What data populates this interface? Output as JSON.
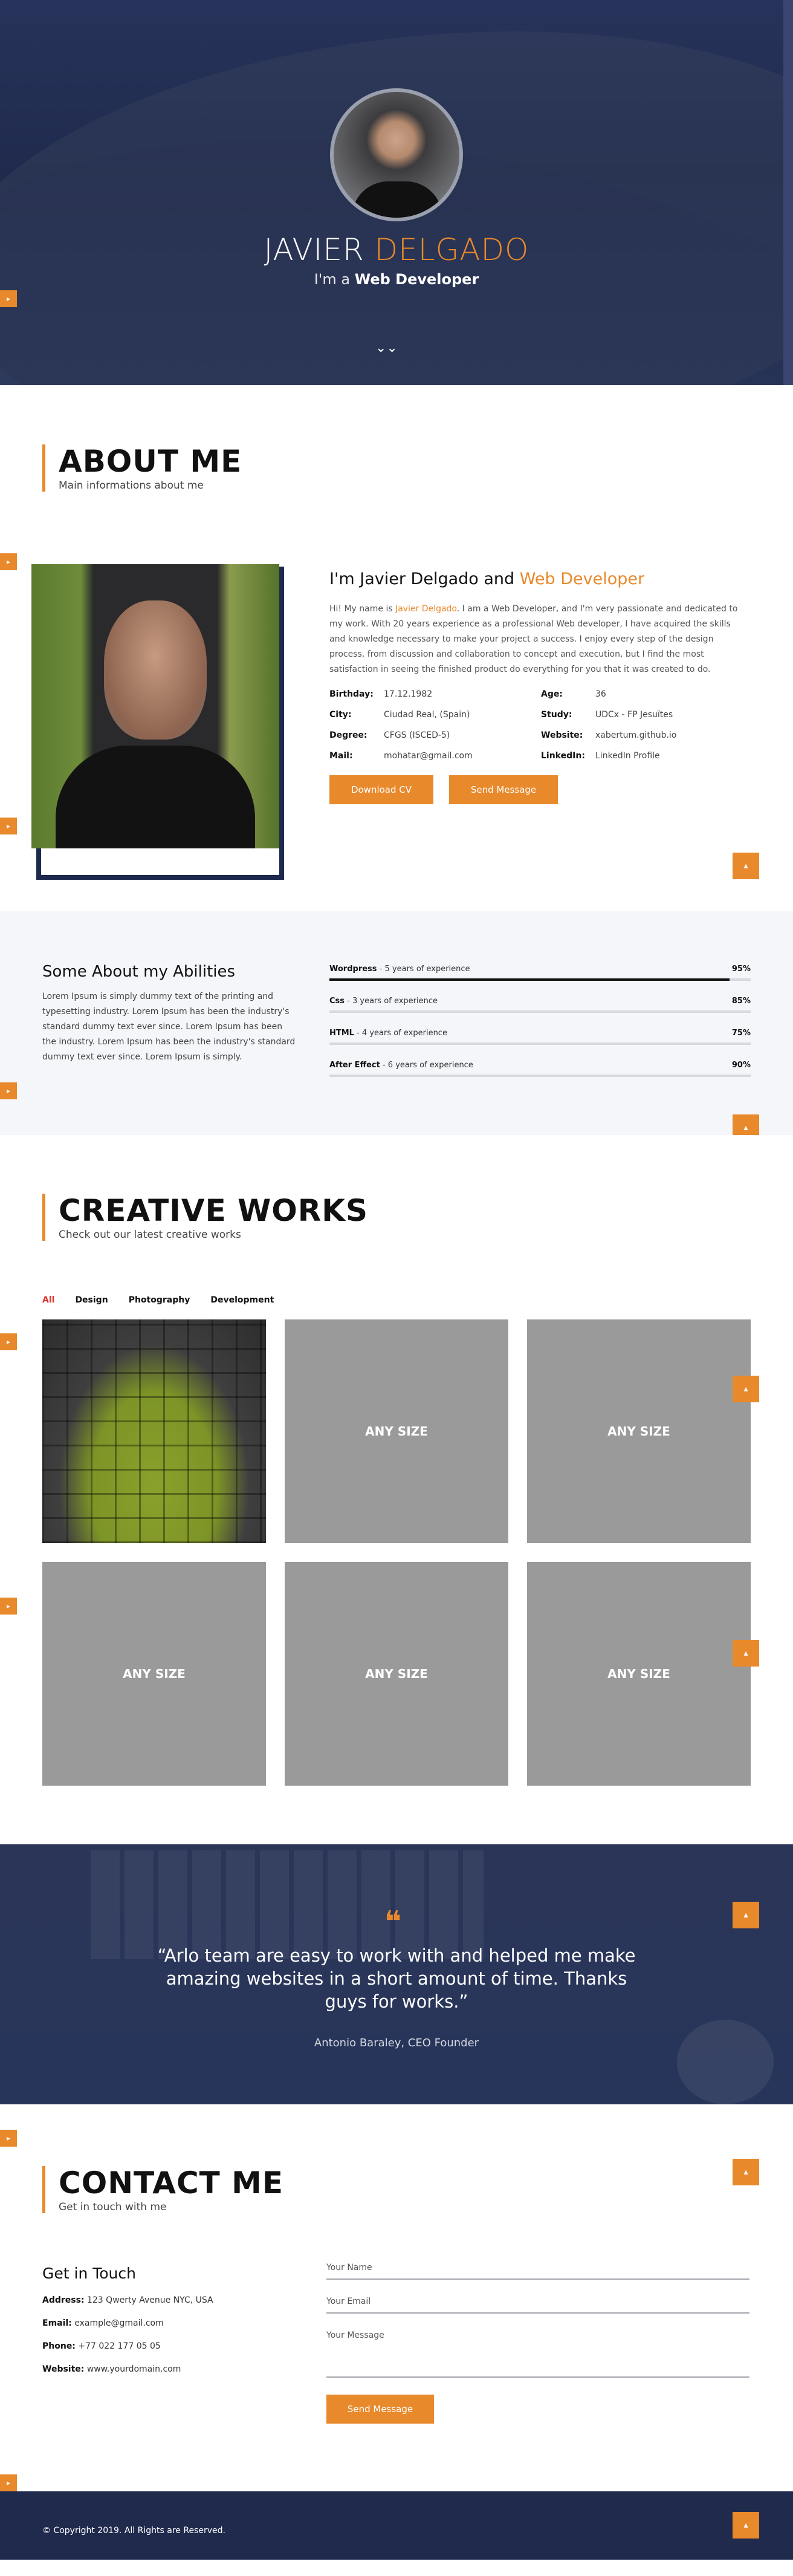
{
  "hero": {
    "first_name": "JAVIER ",
    "last_name": "DELGADO",
    "sub_prefix": "I'm a ",
    "sub_role": "Web Developer",
    "down_icon": "chevron-double-down-icon"
  },
  "side_tab_icon": "chevron-right-icon",
  "to_top_icon": "chevron-up-icon",
  "about": {
    "title": "ABOUT ME",
    "subtitle": "Main informations about me",
    "heading_prefix": "I'm Javier Delgado and ",
    "heading_accent": "Web Developer",
    "intro_prefix": "Hi! My name is ",
    "intro_name": "Javier Delgado",
    "intro_rest": ". I am a Web Developer, and I'm very passionate and dedicated to my work. With 20 years experience as a professional Web developer, I have acquired the skills and knowledge necessary to make your project a success. I enjoy every step of the design process, from discussion and collaboration to concept and execution, but I find the most satisfaction in seeing the finished product do everything for you that it was created to do.",
    "info": [
      {
        "key": "Birthday:",
        "value": "17.12.1982"
      },
      {
        "key": "Age:",
        "value": "36"
      },
      {
        "key": "City:",
        "value": "Ciudad Real, (Spain)"
      },
      {
        "key": "Study:",
        "value": "UDCx - FP Jesuïtes"
      },
      {
        "key": "Degree:",
        "value": "CFGS (ISCED-5)"
      },
      {
        "key": "Website:",
        "value": "xabertum.github.io"
      },
      {
        "key": "Mail:",
        "value": "mohatar@gmail.com"
      },
      {
        "key": "LinkedIn:",
        "value": "LinkedIn Profile"
      }
    ],
    "btn_cv": "Download CV",
    "btn_msg": "Send Message"
  },
  "abilities": {
    "title": "Some About my Abilities",
    "text": "Lorem Ipsum is simply dummy text of the printing and typesetting industry. Lorem Ipsum has been the industry's standard dummy text ever since. Lorem Ipsum has been the industry. Lorem Ipsum has been the industry's standard dummy text ever since. Lorem Ipsum is simply.",
    "skills": [
      {
        "name": "Wordpress",
        "detail": " - 5 years of experience",
        "pct": "95%",
        "value": 95
      },
      {
        "name": "Css",
        "detail": " - 3 years of experience",
        "pct": "85%",
        "value": 85
      },
      {
        "name": "HTML",
        "detail": " - 4 years of experience",
        "pct": "75%",
        "value": 75
      },
      {
        "name": "After Effect",
        "detail": " - 6 years of experience",
        "pct": "90%",
        "value": 90
      }
    ]
  },
  "works": {
    "title": "CREATIVE WORKS",
    "subtitle": "Check out our latest creative works",
    "filters": [
      "All",
      "Design",
      "Photography",
      "Development"
    ],
    "tile_label": "ANY SIZE"
  },
  "testimonial": {
    "quote_icon": "quote-icon",
    "quote": "“Arlo team are easy to work with and helped me make amazing websites in a short amount of time. Thanks guys for works.”",
    "author": "Antonio Baraley, CEO Founder"
  },
  "contact": {
    "title": "CONTACT ME",
    "subtitle": "Get in touch with me",
    "left_title": "Get in Touch",
    "address_label": "Address:",
    "address": " 123 Qwerty Avenue NYC, USA",
    "email_label": "Email:",
    "email": " example@gmail.com",
    "phone_label": "Phone:",
    "phone": " +77 022 177 05 05",
    "website_label": "Website:",
    "website": " www.yourdomain.com",
    "name_placeholder": "Your Name",
    "email_placeholder": "Your Email",
    "message_placeholder": "Your Message",
    "send": "Send Message"
  },
  "footer": {
    "copyright": "© Copyright 2019. All Rights are Reserved."
  },
  "colors": {
    "accent": "#e8892b",
    "navy": "#1f2a4d",
    "filter_active": "#d9322a"
  }
}
